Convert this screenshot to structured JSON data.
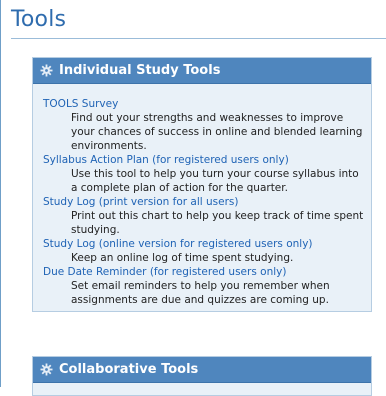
{
  "page": {
    "title": "Tools"
  },
  "individual": {
    "header": "Individual Study Tools",
    "header_icon": "gear-icon",
    "items": [
      {
        "title": "TOOLS Survey",
        "desc": "Find out your strengths and weaknesses to improve your chances of success in online and blended learning environments."
      },
      {
        "title": "Syllabus Action Plan (for registered users only)",
        "desc": "Use this tool to help you turn your course syllabus into a complete plan of action for the quarter."
      },
      {
        "title": "Study Log (print version for all users)",
        "desc": "Print out this chart to help you keep track of time spent studying."
      },
      {
        "title": "Study Log (online version for registered users only)",
        "desc": "Keep an online log of time spent studying."
      },
      {
        "title": "Due Date Reminder (for registered users only)",
        "desc": "Set email reminders to help you remember when assignments are due and quizzes are coming up."
      }
    ]
  },
  "collaborative": {
    "header": "Collaborative Tools",
    "header_icon": "gear-icon"
  },
  "colors": {
    "title": "#2f6cae",
    "header_bg": "#4f86be",
    "panel_bg": "#e9f1f8",
    "link": "#1f63b5"
  }
}
